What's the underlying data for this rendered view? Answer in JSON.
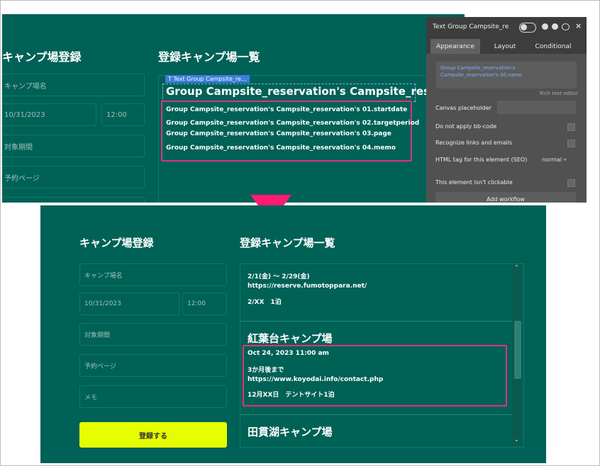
{
  "top": {
    "left_heading": "キャンプ場登録",
    "right_heading": "登録キャンプ場一覧",
    "fields": [
      "キャンプ場名",
      "10/31/2023",
      "12:00",
      "対象期間",
      "予約ページ"
    ],
    "element_tag": "T  Text Group Campsite_re...",
    "title": "Group Campsite_reservation's Campsite_res...",
    "lines": [
      "Group Campsite_reservation's Campsite_reservation's 01.startdate",
      "Group Campsite_reservation's Campsite_reservation's 02.targetperiod",
      "Group Campsite_reservation's Campsite_reservation's 03.page",
      "Group Campsite_reservation's Campsite_reservation's 04.memo"
    ]
  },
  "panel": {
    "title": "Text Group Campsite_re",
    "tabs": [
      "Appearance",
      "Layout",
      "Conditional"
    ],
    "dynamic_text": "Group Campsite_reservation's Campsite_reservation's 00.name",
    "rich_text": "Rich text editor",
    "canvas_placeholder": "Canvas placeholder",
    "no_bb": "Do not apply bb-code",
    "recognize": "Recognize links and emails",
    "html_tag": "HTML tag for this element (SEO)",
    "html_tag_value": "normal",
    "not_clickable": "This element isn't clickable",
    "add_workflow": "Add workflow"
  },
  "bottom": {
    "left_heading": "キャンプ場登録",
    "right_heading": "登録キャンプ場一覧",
    "fields": [
      "キャンプ場名",
      "10/31/2023",
      "12:00",
      "対象期間",
      "予約ページ",
      "メモ"
    ],
    "submit": "登録する",
    "item0": [
      "2/1(金) ～ 2/29(金)",
      "https://reserve.fumotoppara.net/",
      "2/XX　1泊"
    ],
    "item1": {
      "name": "紅葉台キャンプ場",
      "lines": [
        "Oct 24, 2023 11:00 am",
        "3か月後まで",
        "https://www.koyodai.info/contact.php",
        "12月XX日　テントサイト1泊"
      ]
    },
    "item2": {
      "name": "田貫湖キャンプ場"
    }
  },
  "colors": {
    "background": "#006156",
    "highlight": "#e0317a",
    "arrow": "#ff1b73",
    "button": "#e6ff00"
  }
}
